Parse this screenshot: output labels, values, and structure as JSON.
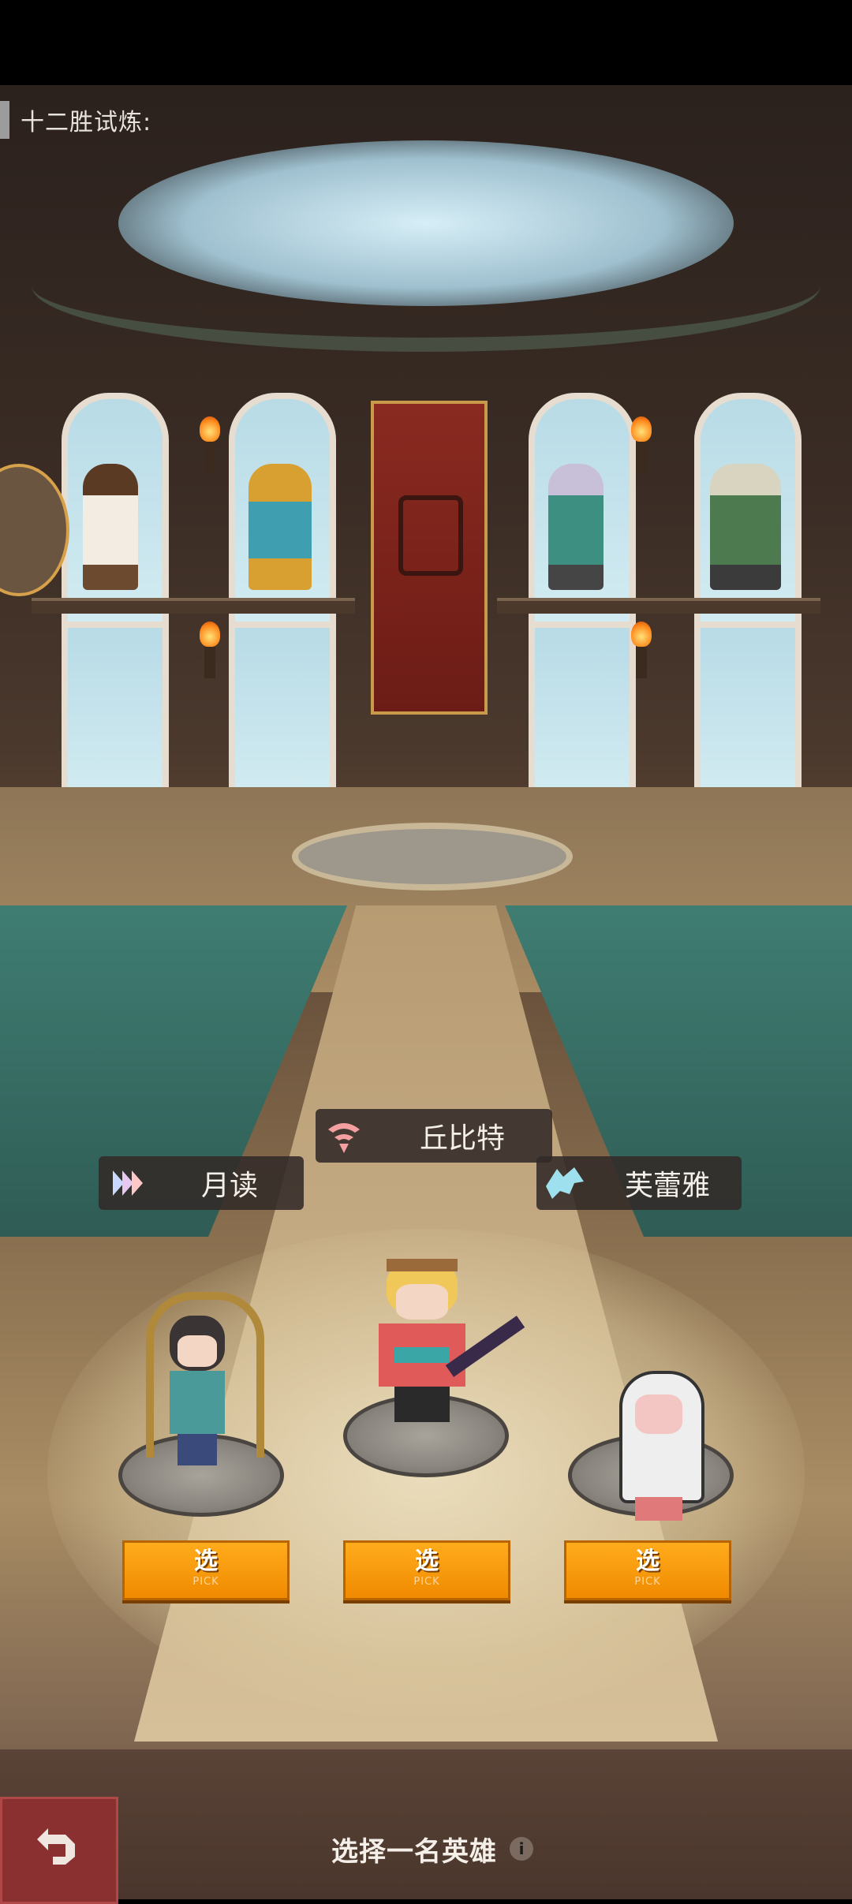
{
  "header": {
    "title": "十二胜试炼:"
  },
  "heroes": [
    {
      "name": "月读",
      "emblem_icon": "triple-blade-emblem-icon",
      "pick_label": "选",
      "pick_sub": "PICK"
    },
    {
      "name": "丘比特",
      "emblem_icon": "swirl-emblem-icon",
      "pick_label": "选",
      "pick_sub": "PICK"
    },
    {
      "name": "芙蕾雅",
      "emblem_icon": "wolf-emblem-icon",
      "pick_label": "选",
      "pick_sub": "PICK"
    }
  ],
  "footer": {
    "prompt": "选择一名英雄",
    "info_icon": "info-icon",
    "back_icon": "back-arrow-icon"
  },
  "colors": {
    "accent": "#f59300",
    "plate": "#322a28",
    "background": "#3b2d25"
  }
}
